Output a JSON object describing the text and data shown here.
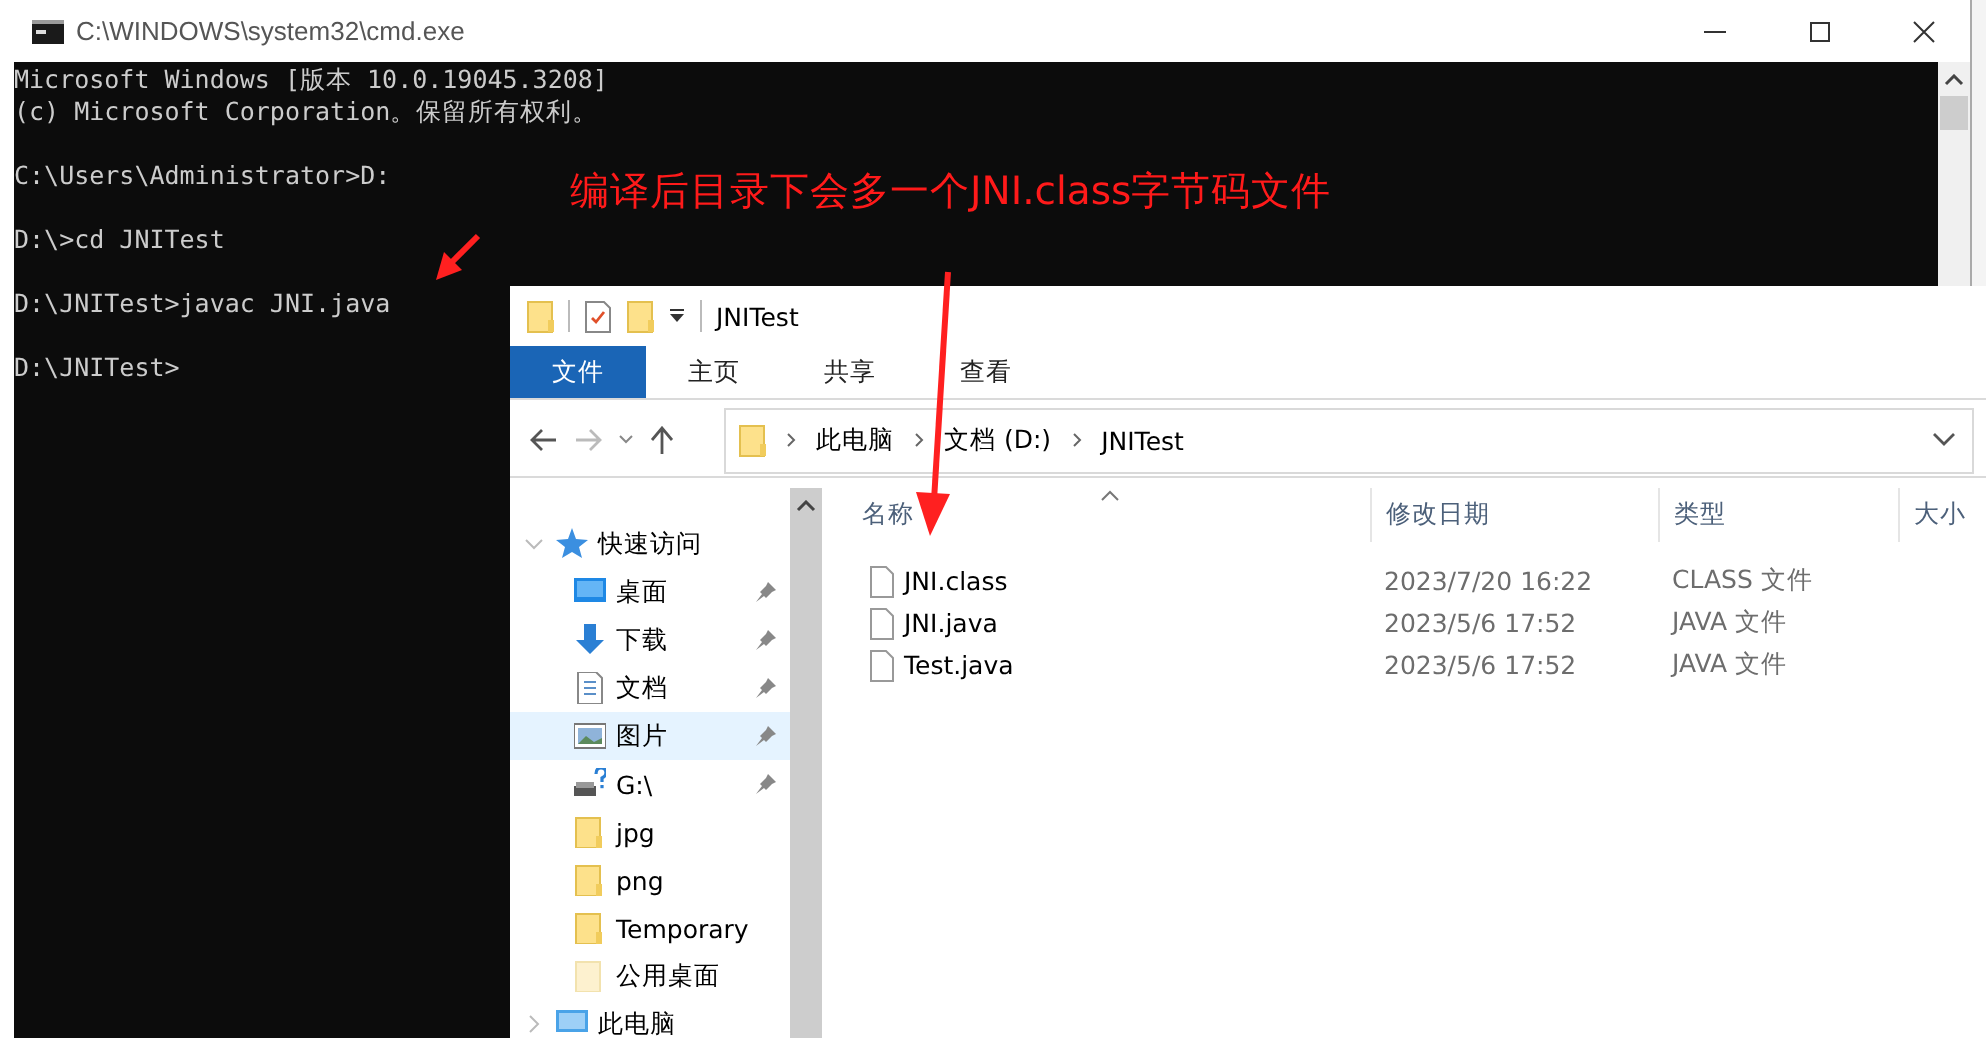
{
  "console_window": {
    "title": "C:\\WINDOWS\\system32\\cmd.exe",
    "blocks": [
      [
        "Microsoft Windows [版本 10.0.19045.3208]",
        "(c) Microsoft Corporation。保留所有权利。"
      ],
      [
        "C:\\Users\\Administrator>D:"
      ],
      [
        "D:\\>cd JNITest"
      ],
      [
        "D:\\JNITest>javac JNI.java"
      ],
      [
        "D:\\JNITest>"
      ]
    ]
  },
  "explorer_window": {
    "title": "JNITest",
    "ribbon_tabs": [
      {
        "label": "文件",
        "selected": true
      },
      {
        "label": "主页",
        "selected": false
      },
      {
        "label": "共享",
        "selected": false
      },
      {
        "label": "查看",
        "selected": false
      }
    ],
    "breadcrumb": [
      "此电脑",
      "文档 (D:)",
      "JNITest"
    ],
    "nav_items": [
      {
        "label": "快速访问",
        "kind": "star",
        "expanded": true,
        "selected": false,
        "children": [
          {
            "label": "桌面",
            "kind": "desktop",
            "pinned": true,
            "selected": false
          },
          {
            "label": "下载",
            "kind": "download",
            "pinned": true,
            "selected": false
          },
          {
            "label": "文档",
            "kind": "document",
            "pinned": true,
            "selected": false
          },
          {
            "label": "图片",
            "kind": "pictures",
            "pinned": true,
            "selected": true
          },
          {
            "label": "G:\\",
            "kind": "drive",
            "pinned": true,
            "selected": false
          },
          {
            "label": "jpg",
            "kind": "folder",
            "pinned": false,
            "selected": false
          },
          {
            "label": "png",
            "kind": "folder",
            "pinned": false,
            "selected": false
          },
          {
            "label": "Temporary",
            "kind": "folder",
            "pinned": false,
            "selected": false
          },
          {
            "label": "公用桌面",
            "kind": "folder-faded",
            "pinned": false,
            "selected": false
          }
        ]
      },
      {
        "label": "此电脑",
        "kind": "pc",
        "expanded": false,
        "selected": false
      }
    ],
    "columns": [
      {
        "label": "名称",
        "sorted": true
      },
      {
        "label": "修改日期",
        "sorted": false
      },
      {
        "label": "类型",
        "sorted": false
      },
      {
        "label": "大小",
        "sorted": false
      }
    ],
    "files": [
      {
        "name": "JNI.class",
        "modified": "2023/7/20 16:22",
        "type": "CLASS 文件"
      },
      {
        "name": "JNI.java",
        "modified": "2023/5/6 17:52",
        "type": "JAVA 文件"
      },
      {
        "name": "Test.java",
        "modified": "2023/5/6 17:52",
        "type": "JAVA 文件"
      }
    ]
  },
  "annotation": {
    "text": "编译后目录下会多一个JNI.class字节码文件"
  }
}
